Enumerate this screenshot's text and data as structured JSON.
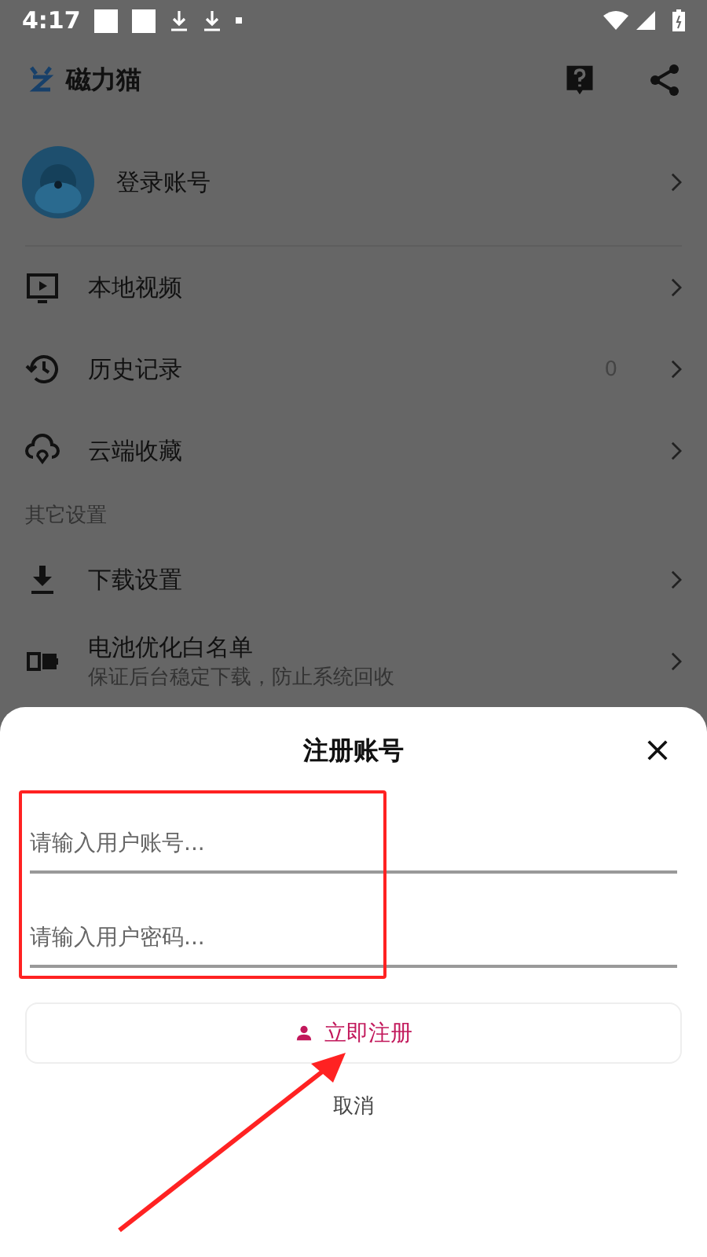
{
  "status_bar": {
    "time": "4:17"
  },
  "app_bar": {
    "title": "磁力猫"
  },
  "account": {
    "label": "登录账号"
  },
  "menu": [
    {
      "label": "本地视频"
    },
    {
      "label": "历史记录",
      "count": "0"
    },
    {
      "label": "云端收藏"
    }
  ],
  "section_label": "其它设置",
  "settings": [
    {
      "label": "下载设置"
    },
    {
      "label": "电池优化白名单",
      "subtitle": "保证后台稳定下载，防止系统回收"
    }
  ],
  "sheet": {
    "title": "注册账号",
    "fields": [
      {
        "placeholder": "请输入用户账号..."
      },
      {
        "placeholder": "请输入用户密码..."
      }
    ],
    "submit": "立即注册",
    "cancel": "取消"
  }
}
